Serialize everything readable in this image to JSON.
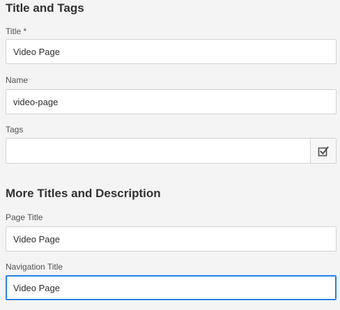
{
  "title_and_tags": {
    "heading": "Title and Tags",
    "title": {
      "label": "Title *",
      "value": "Video Page"
    },
    "name": {
      "label": "Name",
      "value": "video-page"
    },
    "tags": {
      "label": "Tags",
      "value": "",
      "button_icon": "checkbox-picker-icon"
    }
  },
  "more_titles": {
    "heading": "More Titles and Description",
    "page_title": {
      "label": "Page Title",
      "value": "Video Page"
    },
    "navigation_title": {
      "label": "Navigation Title",
      "value": "Video Page"
    }
  },
  "colors": {
    "focus_border": "#2680eb",
    "background": "#f4f4f4"
  }
}
